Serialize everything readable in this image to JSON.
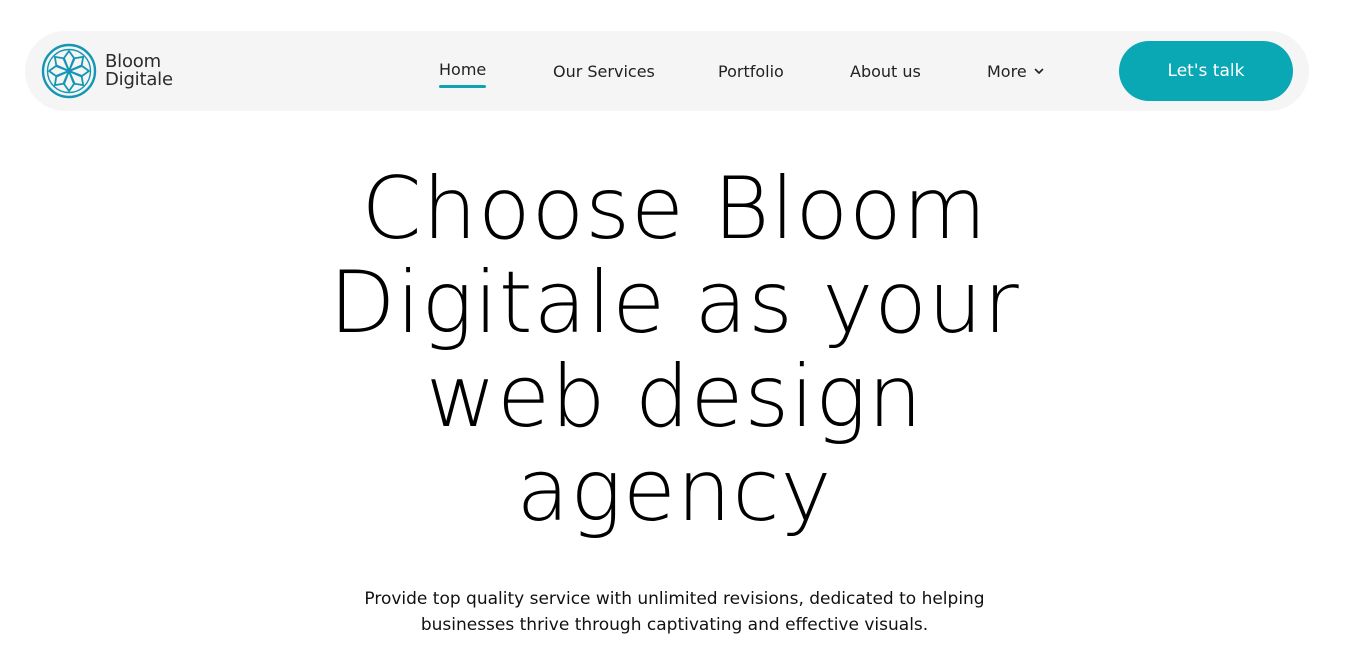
{
  "brand": {
    "name_line1": "Bloom",
    "name_line2": "Digitale",
    "accent_color": "#0aa8b5",
    "logo_icon": "flower-logo-icon"
  },
  "nav": {
    "items": [
      {
        "label": "Home",
        "active": true
      },
      {
        "label": "Our Services",
        "active": false
      },
      {
        "label": "Portfolio",
        "active": false
      },
      {
        "label": "About us",
        "active": false
      },
      {
        "label": "More",
        "active": false,
        "icon": "chevron-down-icon"
      }
    ],
    "cta_label": "Let's talk"
  },
  "hero": {
    "title_lines": [
      "Choose Bloom",
      "Digitale as your",
      "web design",
      "agency"
    ],
    "subtitle_lines": [
      "Provide top quality service with unlimited revisions, dedicated to helping",
      "businesses thrive through captivating and effective visuals."
    ]
  }
}
